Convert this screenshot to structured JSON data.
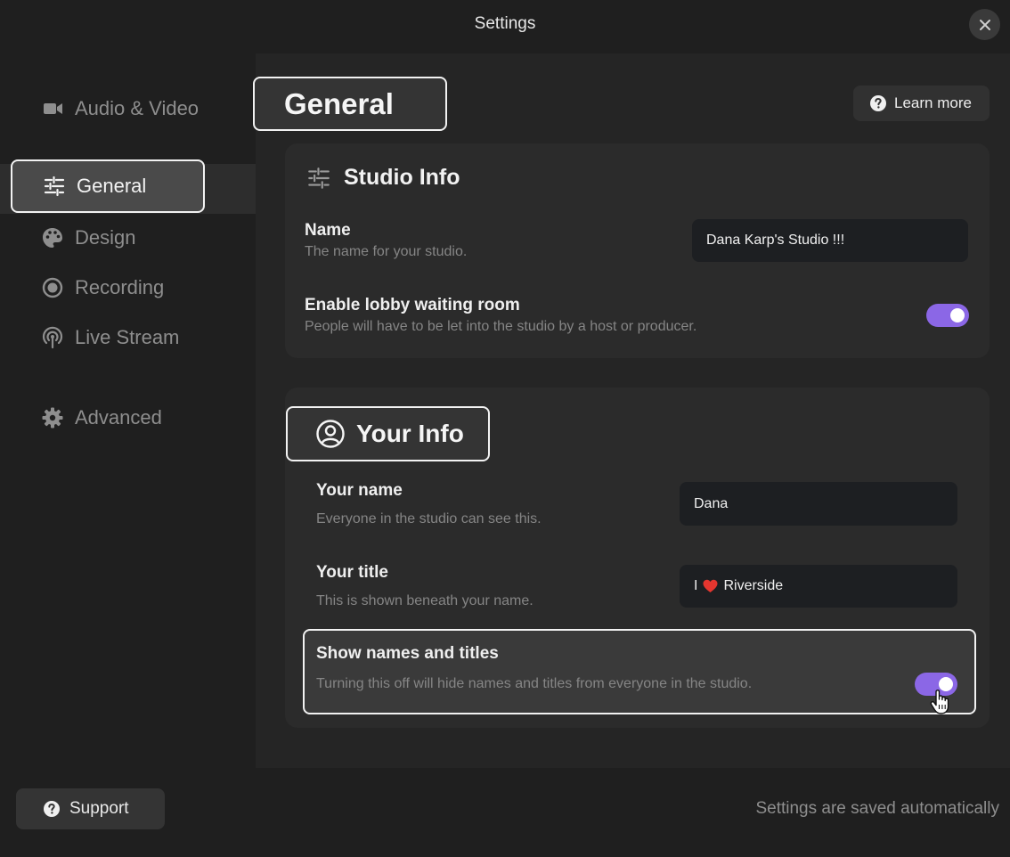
{
  "window": {
    "title": "Settings"
  },
  "sidebar": {
    "items": [
      {
        "label": "Audio & Video",
        "icon": "video-camera-icon"
      },
      {
        "label": "General",
        "icon": "sliders-icon",
        "active": true
      },
      {
        "label": "Design",
        "icon": "palette-icon"
      },
      {
        "label": "Recording",
        "icon": "record-icon"
      },
      {
        "label": "Live Stream",
        "icon": "broadcast-icon"
      },
      {
        "label": "Advanced",
        "icon": "gear-icon"
      }
    ]
  },
  "main": {
    "page_title": "General",
    "learn_more_label": "Learn more",
    "studio_info": {
      "heading": "Studio Info",
      "name_label": "Name",
      "name_desc": "The name for your studio.",
      "name_value": "Dana Karp's Studio !!!",
      "lobby_label": "Enable lobby waiting room",
      "lobby_desc": "People will have to be let into the studio by a host or producer.",
      "lobby_enabled": true
    },
    "your_info": {
      "heading": "Your Info",
      "your_name_label": "Your name",
      "your_name_desc": "Everyone in the studio can see this.",
      "your_name_value": "Dana",
      "your_title_label": "Your title",
      "your_title_desc": "This is shown beneath your name.",
      "your_title_prefix": "I",
      "your_title_suffix": "Riverside",
      "show_names_label": "Show names and titles",
      "show_names_desc": "Turning this off will hide names and titles from everyone in the studio.",
      "show_names_enabled": true
    }
  },
  "footer": {
    "support_label": "Support",
    "saved_note": "Settings are saved automatically"
  },
  "colors": {
    "accent": "#8b67e6",
    "background": "#1f1f1f",
    "panel": "#252525",
    "card": "#2b2b2b"
  }
}
